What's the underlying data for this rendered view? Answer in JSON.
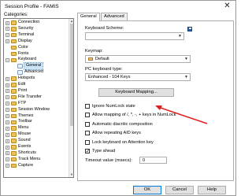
{
  "window": {
    "title": "Session Profile - FAMIS",
    "close_glyph": "✕"
  },
  "categories": {
    "label": "Categories:",
    "items": [
      {
        "label": "Connection",
        "expander": "+"
      },
      {
        "label": "Security",
        "expander": "+"
      },
      {
        "label": "Terminal",
        "expander": "+"
      },
      {
        "label": "Display",
        "expander": "+"
      },
      {
        "label": "Color",
        "expander": ""
      },
      {
        "label": "Fonts",
        "expander": ""
      },
      {
        "label": "Keyboard",
        "expander": "−"
      },
      {
        "label": "General",
        "expander": "",
        "child": true,
        "selected": true
      },
      {
        "label": "Advanced",
        "expander": "",
        "child": true
      },
      {
        "label": "Hotspots",
        "expander": "+"
      },
      {
        "label": "Edit",
        "expander": "+"
      },
      {
        "label": "Print",
        "expander": "+"
      },
      {
        "label": "File Transfer",
        "expander": "+"
      },
      {
        "label": "FTP",
        "expander": "+"
      },
      {
        "label": "Session Window",
        "expander": "+"
      },
      {
        "label": "Themes",
        "expander": "+"
      },
      {
        "label": "Toolbar",
        "expander": "+"
      },
      {
        "label": "Menu",
        "expander": "+"
      },
      {
        "label": "Mouse",
        "expander": "+"
      },
      {
        "label": "Sound",
        "expander": "+"
      },
      {
        "label": "Events",
        "expander": "+"
      },
      {
        "label": "Shortcuts",
        "expander": "+"
      },
      {
        "label": "Track Menu",
        "expander": "+"
      },
      {
        "label": "Capture",
        "expander": "+"
      }
    ]
  },
  "tabs": [
    {
      "label": "General",
      "active": true
    },
    {
      "label": "Advanced",
      "active": false
    }
  ],
  "general": {
    "keyboard_scheme_label": "Keyboard Scheme:",
    "keyboard_scheme_value": "",
    "keymap_label": "Keymap:",
    "keymap_value": "Default",
    "pc_keyboard_type_label": "PC keyboard type:",
    "pc_keyboard_type_value": "Enhanced - 104 Keys",
    "keyboard_mapping_button": "Keyboard Mapping...",
    "options": [
      {
        "label": "Ignore NumLock state",
        "checked": false
      },
      {
        "label": "Allow mapping of /, *, -, + keys in NumLock",
        "checked": false
      },
      {
        "label": "Automatic diacritic composition",
        "checked": false
      },
      {
        "label": "Allow repeating AID keys",
        "checked": false
      },
      {
        "label": "Lock keyboard on Attention key",
        "checked": false
      },
      {
        "label": "Type ahead",
        "checked": true
      }
    ],
    "timeout_label": "Timeout value (msecs):",
    "timeout_value": "0"
  },
  "footer": {
    "ok": "OK",
    "cancel": "Cancel",
    "help": "Help"
  },
  "colors": {
    "annotation_arrow": "#e02020",
    "selection": "#cce4f7",
    "primary_border": "#0078d7"
  }
}
